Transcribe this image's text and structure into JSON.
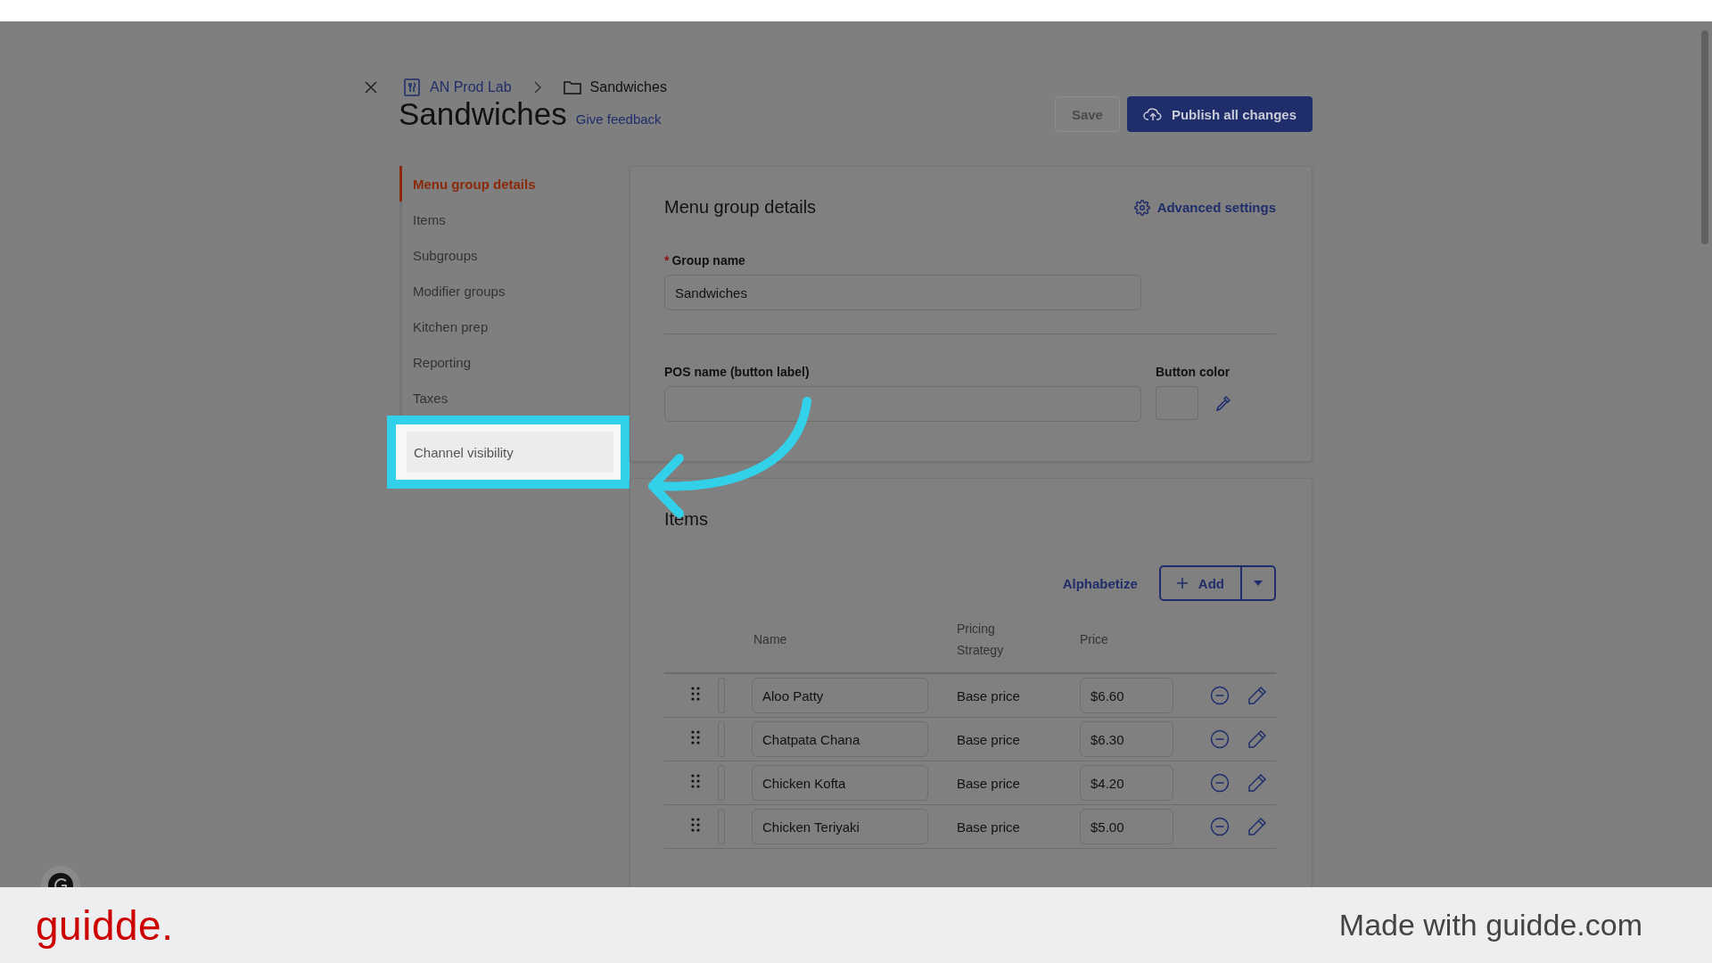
{
  "breadcrumb": [
    {
      "label": "AN Prod Lab",
      "kind": "restaurant"
    },
    {
      "label": "Sandwiches",
      "kind": "folder"
    }
  ],
  "page": {
    "title": "Sandwiches",
    "feedback_link": "Give feedback"
  },
  "actions": {
    "save": {
      "label": "Save",
      "disabled": true
    },
    "publish": {
      "label": "Publish all changes"
    }
  },
  "sidebar": {
    "items": [
      {
        "label": "Menu group details",
        "selected": true,
        "highlighted": false
      },
      {
        "label": "Items",
        "selected": false,
        "highlighted": false
      },
      {
        "label": "Subgroups",
        "selected": false,
        "highlighted": false
      },
      {
        "label": "Modifier groups",
        "selected": false,
        "highlighted": false
      },
      {
        "label": "Kitchen prep",
        "selected": false,
        "highlighted": false
      },
      {
        "label": "Reporting",
        "selected": false,
        "highlighted": false
      },
      {
        "label": "Taxes",
        "selected": false,
        "highlighted": false
      },
      {
        "label": "Channel visibility",
        "selected": false,
        "highlighted": true
      }
    ]
  },
  "details": {
    "title": "Menu group details",
    "advanced_settings": "Advanced settings",
    "group_name": {
      "label": "Group name",
      "required": true,
      "required_mark": "*",
      "value": "Sandwiches"
    },
    "pos_name": {
      "label": "POS name (button label)"
    },
    "button_color": {
      "label": "Button color"
    }
  },
  "items": {
    "title": "Items",
    "alphabetize": "Alphabetize",
    "add": "Add",
    "columns": [
      "Name",
      "Pricing Strategy",
      "Price"
    ],
    "rows": [
      {
        "name": "Aloo Patty",
        "pricing": "Base price",
        "price": "$6.60"
      },
      {
        "name": "Chatpata Chana",
        "pricing": "Base price",
        "price": "$6.30"
      },
      {
        "name": "Chicken Kofta",
        "pricing": "Base price",
        "price": "$4.20"
      },
      {
        "name": "Chicken Teriyaki",
        "pricing": "Base price",
        "price": "$5.00"
      }
    ]
  },
  "footer": {
    "brand": "guidde.",
    "credit": "Made with guidde.com"
  }
}
